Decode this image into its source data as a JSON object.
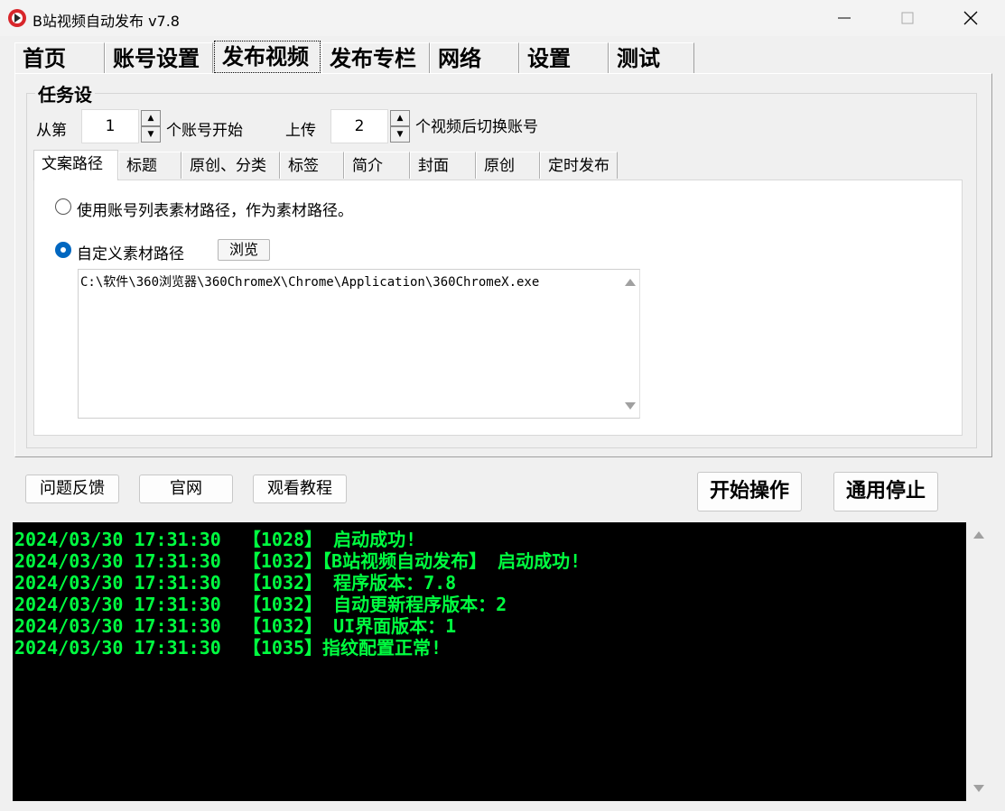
{
  "window": {
    "title": "B站视频自动发布  v7.8"
  },
  "main_tabs": [
    "首页",
    "账号设置",
    "发布视频",
    "发布专栏",
    "网络",
    "设置",
    "测试"
  ],
  "task": {
    "group_title": "任务设",
    "from_label": "从第",
    "start_value": "1",
    "start_suffix": "个账号开始",
    "upload_label": "上传",
    "upload_value": "2",
    "upload_suffix": "个视频后切换账号"
  },
  "sub_tabs": [
    "文案路径",
    "标题",
    "原创、分类",
    "标签",
    "简介",
    "封面",
    "原创",
    "定时发布"
  ],
  "copy_path": {
    "option_list": "使用账号列表素材路径，作为素材路径。",
    "option_custom": "自定义素材路径",
    "browse_label": "浏览",
    "path_value": "C:\\软件\\360浏览器\\360ChromeX\\Chrome\\Application\\360ChromeX.exe"
  },
  "buttons": {
    "feedback": "问题反馈",
    "website": "官网",
    "tutorial": "观看教程",
    "start": "开始操作",
    "stop": "通用停止"
  },
  "log": [
    "2024/03/30 17:31:30  【1028】 启动成功!",
    "2024/03/30 17:31:30  【1032】【B站视频自动发布】 启动成功!",
    "2024/03/30 17:31:30  【1032】 程序版本：7.8",
    "2024/03/30 17:31:30  【1032】 自动更新程序版本：2",
    "2024/03/30 17:31:30  【1032】 UI界面版本：1",
    "2024/03/30 17:31:30  【1035】指纹配置正常!"
  ],
  "colors": {
    "log_text": "#00ff40",
    "log_bg": "#000000",
    "radio_accent": "#0067c0"
  }
}
